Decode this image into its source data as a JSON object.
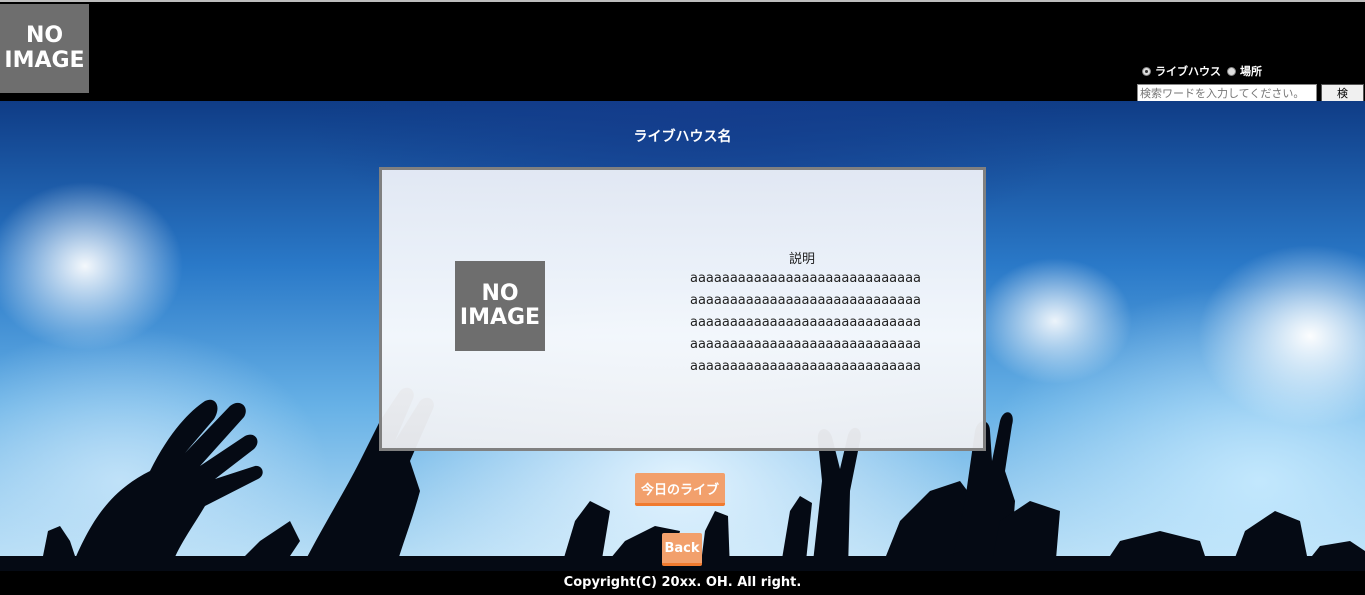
{
  "header": {
    "logo": {
      "line1": "NO",
      "line2": "IMAGE"
    },
    "search": {
      "radio_livehouse": "ライブハウス",
      "radio_place": "場所",
      "placeholder": "検索ワードを入力してください。",
      "button": "検 索"
    }
  },
  "main": {
    "venue_name": "ライブハウス名",
    "card": {
      "image": {
        "line1": "NO",
        "line2": "IMAGE"
      },
      "description_title": "説明",
      "description_lines": [
        "aaaaaaaaaaaaaaaaaaaaaaaaaaaaa",
        "aaaaaaaaaaaaaaaaaaaaaaaaaaaaa",
        "aaaaaaaaaaaaaaaaaaaaaaaaaaaaa",
        "aaaaaaaaaaaaaaaaaaaaaaaaaaaaa",
        "aaaaaaaaaaaaaaaaaaaaaaaaaaaaa"
      ]
    },
    "today_live_button": "今日のライブ",
    "back_button": "Back"
  },
  "footer": {
    "copyright": "Copyright(C) 20xx. OH. All right."
  }
}
